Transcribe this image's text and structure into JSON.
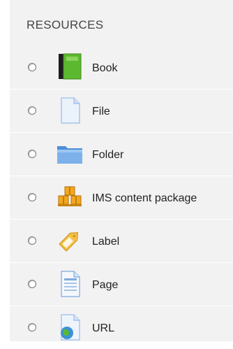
{
  "section": {
    "title": "RESOURCES"
  },
  "resources": [
    {
      "label": "Book",
      "icon": "book-icon",
      "color": "#5cb82e"
    },
    {
      "label": "File",
      "icon": "file-icon",
      "color": "#a9c7ee"
    },
    {
      "label": "Folder",
      "icon": "folder-icon",
      "color": "#6fa4e4"
    },
    {
      "label": "IMS content package",
      "icon": "package-icon",
      "color": "#f2a81d"
    },
    {
      "label": "Label",
      "icon": "label-tag-icon",
      "color": "#f5c24a"
    },
    {
      "label": "Page",
      "icon": "page-icon",
      "color": "#7ea9dc"
    },
    {
      "label": "URL",
      "icon": "url-globe-icon",
      "color": "#4aa3d8"
    }
  ]
}
